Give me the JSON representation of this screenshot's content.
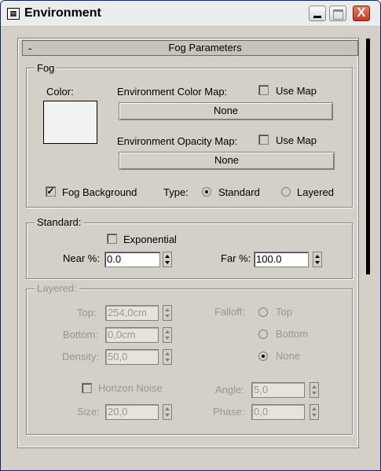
{
  "window": {
    "title": "Environment",
    "minimize_label": "",
    "maximize_label": "",
    "close_label": "X"
  },
  "rollout": {
    "toggle": "-",
    "title": "Fog Parameters"
  },
  "fog": {
    "group_label": "Fog",
    "color_label": "Color:",
    "color_value": "#f2f2f2",
    "env_color_map_label": "Environment Color Map:",
    "env_color_use_map_label": "Use Map",
    "env_color_use_map_checked": false,
    "env_color_map_button": "None",
    "env_opacity_map_label": "Environment Opacity Map:",
    "env_opacity_use_map_label": "Use Map",
    "env_opacity_use_map_checked": false,
    "env_opacity_map_button": "None",
    "fog_background_label": "Fog Background",
    "fog_background_checked": true,
    "type_label": "Type:",
    "type_options": [
      "Standard",
      "Layered"
    ],
    "type_selected": "Standard"
  },
  "standard": {
    "group_label": "Standard:",
    "exponential_label": "Exponential",
    "exponential_checked": false,
    "near_label": "Near %:",
    "near_value": "0.0",
    "far_label": "Far %:",
    "far_value": "100.0"
  },
  "layered": {
    "group_label": "Layered:",
    "top_label": "Top:",
    "top_value": "254,0cm",
    "bottom_label": "Bottom:",
    "bottom_value": "0,0cm",
    "density_label": "Density:",
    "density_value": "50,0",
    "falloff_label": "Falloff:",
    "falloff_options": [
      "Top",
      "Bottom",
      "None"
    ],
    "falloff_selected": "None",
    "horizon_noise_label": "Horizon Noise",
    "horizon_noise_checked": false,
    "size_label": "Size:",
    "size_value": "20,0",
    "angle_label": "Angle:",
    "angle_value": "5,0",
    "phase_label": "Phase:",
    "phase_value": "0,0"
  }
}
